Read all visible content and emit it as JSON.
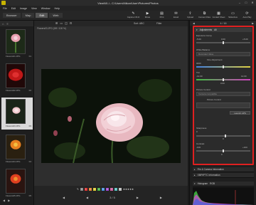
{
  "window": {
    "title": "ViewNX-i - C:\\Users\\Nikon\\User\\Pictures\\Photos",
    "minimize": "–",
    "maximize": "□",
    "close": "✕"
  },
  "menu": [
    "File",
    "Edit",
    "Image",
    "View",
    "Window",
    "Help"
  ],
  "mode_tabs": [
    "Browser",
    "Map",
    "Edit",
    "Web"
  ],
  "active_mode": "Edit",
  "toolbar": [
    {
      "icon": "pencil",
      "label": "Capture NX-D"
    },
    {
      "icon": "movie",
      "label": "Movie"
    },
    {
      "icon": "print",
      "label": "Print"
    },
    {
      "icon": "email",
      "label": "Email"
    },
    {
      "icon": "upload",
      "label": "Upload"
    },
    {
      "icon": "connect",
      "label": "Connect Files"
    },
    {
      "icon": "contact",
      "label": "Contact Sheet"
    },
    {
      "icon": "slideshow",
      "label": "Slideshow"
    },
    {
      "icon": "autoplay",
      "label": "Auto Play"
    }
  ],
  "filmstrip": {
    "header_icons": [
      "⌂",
      "≡"
    ],
    "thumbs": [
      {
        "caption": "Flowers01.JPG",
        "number": "01"
      },
      {
        "caption": "Flowers02.JPG",
        "number": "02"
      },
      {
        "caption": "Flowers03.JPG",
        "number": "03"
      },
      {
        "caption": "Flowers04.JPG",
        "number": "04"
      },
      {
        "caption": "Flowers05.JPG",
        "number": "05"
      }
    ],
    "selected_index": 2,
    "scroll_icons": [
      "◀",
      "▶"
    ]
  },
  "imgbar": {
    "icons": [
      "⊞",
      "▭",
      "◫",
      "⊟"
    ],
    "sort": "Sort: ABC",
    "filter": "Filter"
  },
  "viewer": {
    "filename": "Flowers03.JPG (0/5 / 100 %)"
  },
  "bottombar": {
    "labels": [
      "0",
      "1",
      "2",
      "3",
      "4",
      "5",
      "6",
      "7",
      "8",
      "9"
    ],
    "label_colors": [
      "#888888",
      "#e03030",
      "#e08030",
      "#e0d030",
      "#40b040",
      "#4090e0",
      "#a040d0",
      "#d060a0",
      "#50c0c0",
      "#c0c0c0"
    ],
    "rating": "★★★★★",
    "nav": [
      "◀",
      "◀",
      "3 / 5",
      "▶",
      "▶"
    ]
  },
  "rightpanel": {
    "nav": [
      "◀",
      "4 / 16",
      "▶"
    ],
    "adjustments": {
      "title": "Adjustments",
      "preset": "All",
      "exposure_comp": {
        "label": "Exposure Comp.",
        "min": "-5.00",
        "max": "0.00",
        "max2": "+5.00"
      },
      "white_balance": {
        "label": "White Balance",
        "dropdown": "Recorded Value"
      },
      "fine_adjustment": {
        "label": "Fine Adjustment",
        "value": "0000"
      },
      "tint": {
        "label": "Tint",
        "min": "-12.00",
        "max": "12.00",
        "value": "0.00"
      },
      "picture_control": {
        "label": "Picture Control",
        "dropdown": "Camera compatible",
        "sub": "Picture Control",
        "button": "Launch APS"
      },
      "sharpness": {
        "label": "Sharpness",
        "value": "0",
        "scale": "0"
      },
      "contrast": {
        "label": "Contrast",
        "min": "-100",
        "max": "+100",
        "value": "0"
      }
    },
    "sections": [
      "File & Camera Information",
      "XMP/IPTC Information"
    ],
    "histogram": {
      "title": "Histogram",
      "channel": "RGB"
    }
  }
}
